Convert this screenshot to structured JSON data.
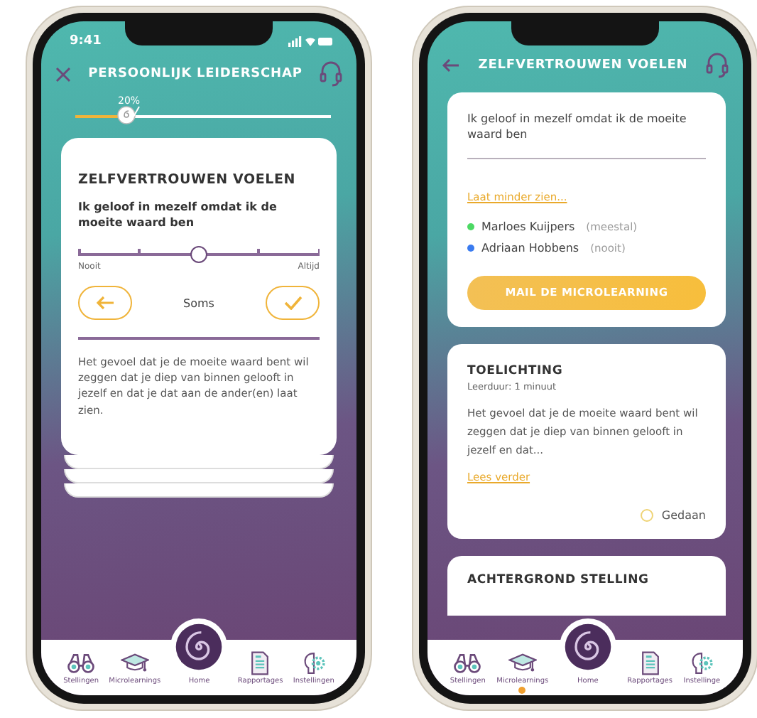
{
  "left_screen": {
    "status_bar": {
      "time": "9:41"
    },
    "header": {
      "title": "PERSOONLIJK LEIDERSCHAP"
    },
    "progress": {
      "label": "20%",
      "level": 0.2
    },
    "card": {
      "title": "ZELFVERTROUWEN VOELEN",
      "question": "Ik geloof in mezelf omdat ik de moeite waard ben",
      "slider": {
        "level": 0.5,
        "min_label": "Nooit",
        "max_label": "Altijd"
      },
      "answer": "Soms",
      "text": "Het gevoel dat je de moeite waard bent wil zeggen dat je diep van binnen gelooft in jezelf en dat je dat aan de ander(en) laat zien."
    },
    "nav": [
      {
        "kind": "binoculars",
        "label": "Stellingen",
        "selected": false
      },
      {
        "kind": "cap",
        "label": "Microlearnings",
        "selected": false
      },
      {
        "kind": "home",
        "label": "Home",
        "selected": false
      },
      {
        "kind": "report",
        "label": "Rapportages",
        "selected": false
      },
      {
        "kind": "brain",
        "label": "Instellingen",
        "selected": false
      }
    ]
  },
  "right_screen": {
    "header": {
      "title": "ZELFVERTROUWEN VOELEN"
    },
    "statement_card": {
      "statement": "Ik geloof in mezelf omdat ik de moeite waard ben",
      "link": "Laat minder zien...",
      "people": [
        {
          "name": "Marloes Kuijpers",
          "answer": "(meestal)",
          "color": "#4cd964"
        },
        {
          "name": "Adriaan Hobbens",
          "answer": "(nooit)",
          "color": "#3a7bf0"
        }
      ],
      "button": "MAIL DE MICROLEARNING"
    },
    "explanation_card": {
      "title": "TOELICHTING",
      "duration": "Leerduur: 1 minuut",
      "text": "Het gevoel dat je de moeite waard bent wil zeggen dat je diep van binnen gelooft in jezelf en dat...",
      "link": "Lees verder",
      "done": {
        "label": "Gedaan",
        "checked": false
      }
    },
    "next_card": {
      "title": "ACHTERGROND STELLING"
    },
    "nav": [
      {
        "kind": "binoculars",
        "label": "Stellingen",
        "selected": false
      },
      {
        "kind": "cap",
        "label": "Microlearnings",
        "selected": true
      },
      {
        "kind": "home",
        "label": "Home",
        "selected": false
      },
      {
        "kind": "report",
        "label": "Rapportages",
        "selected": false
      },
      {
        "kind": "brain",
        "label": "Instellinge",
        "selected": false
      }
    ]
  }
}
